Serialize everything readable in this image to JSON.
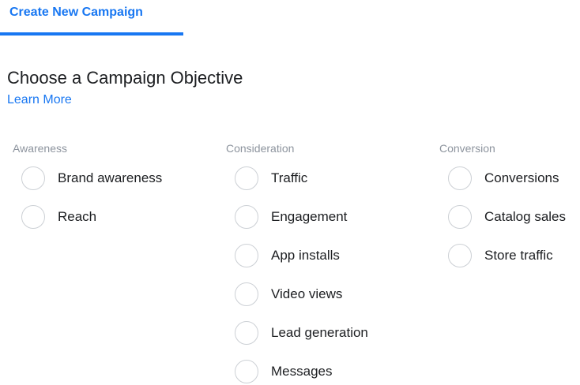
{
  "tab": {
    "label": "Create New Campaign",
    "accent_color": "#1877f2"
  },
  "header": {
    "title": "Choose a Campaign Objective",
    "learn_more": "Learn More"
  },
  "columns": [
    {
      "title": "Awareness",
      "options": [
        "Brand awareness",
        "Reach"
      ]
    },
    {
      "title": "Consideration",
      "options": [
        "Traffic",
        "Engagement",
        "App installs",
        "Video views",
        "Lead generation",
        "Messages"
      ]
    },
    {
      "title": "Conversion",
      "options": [
        "Conversions",
        "Catalog sales",
        "Store traffic"
      ]
    }
  ]
}
